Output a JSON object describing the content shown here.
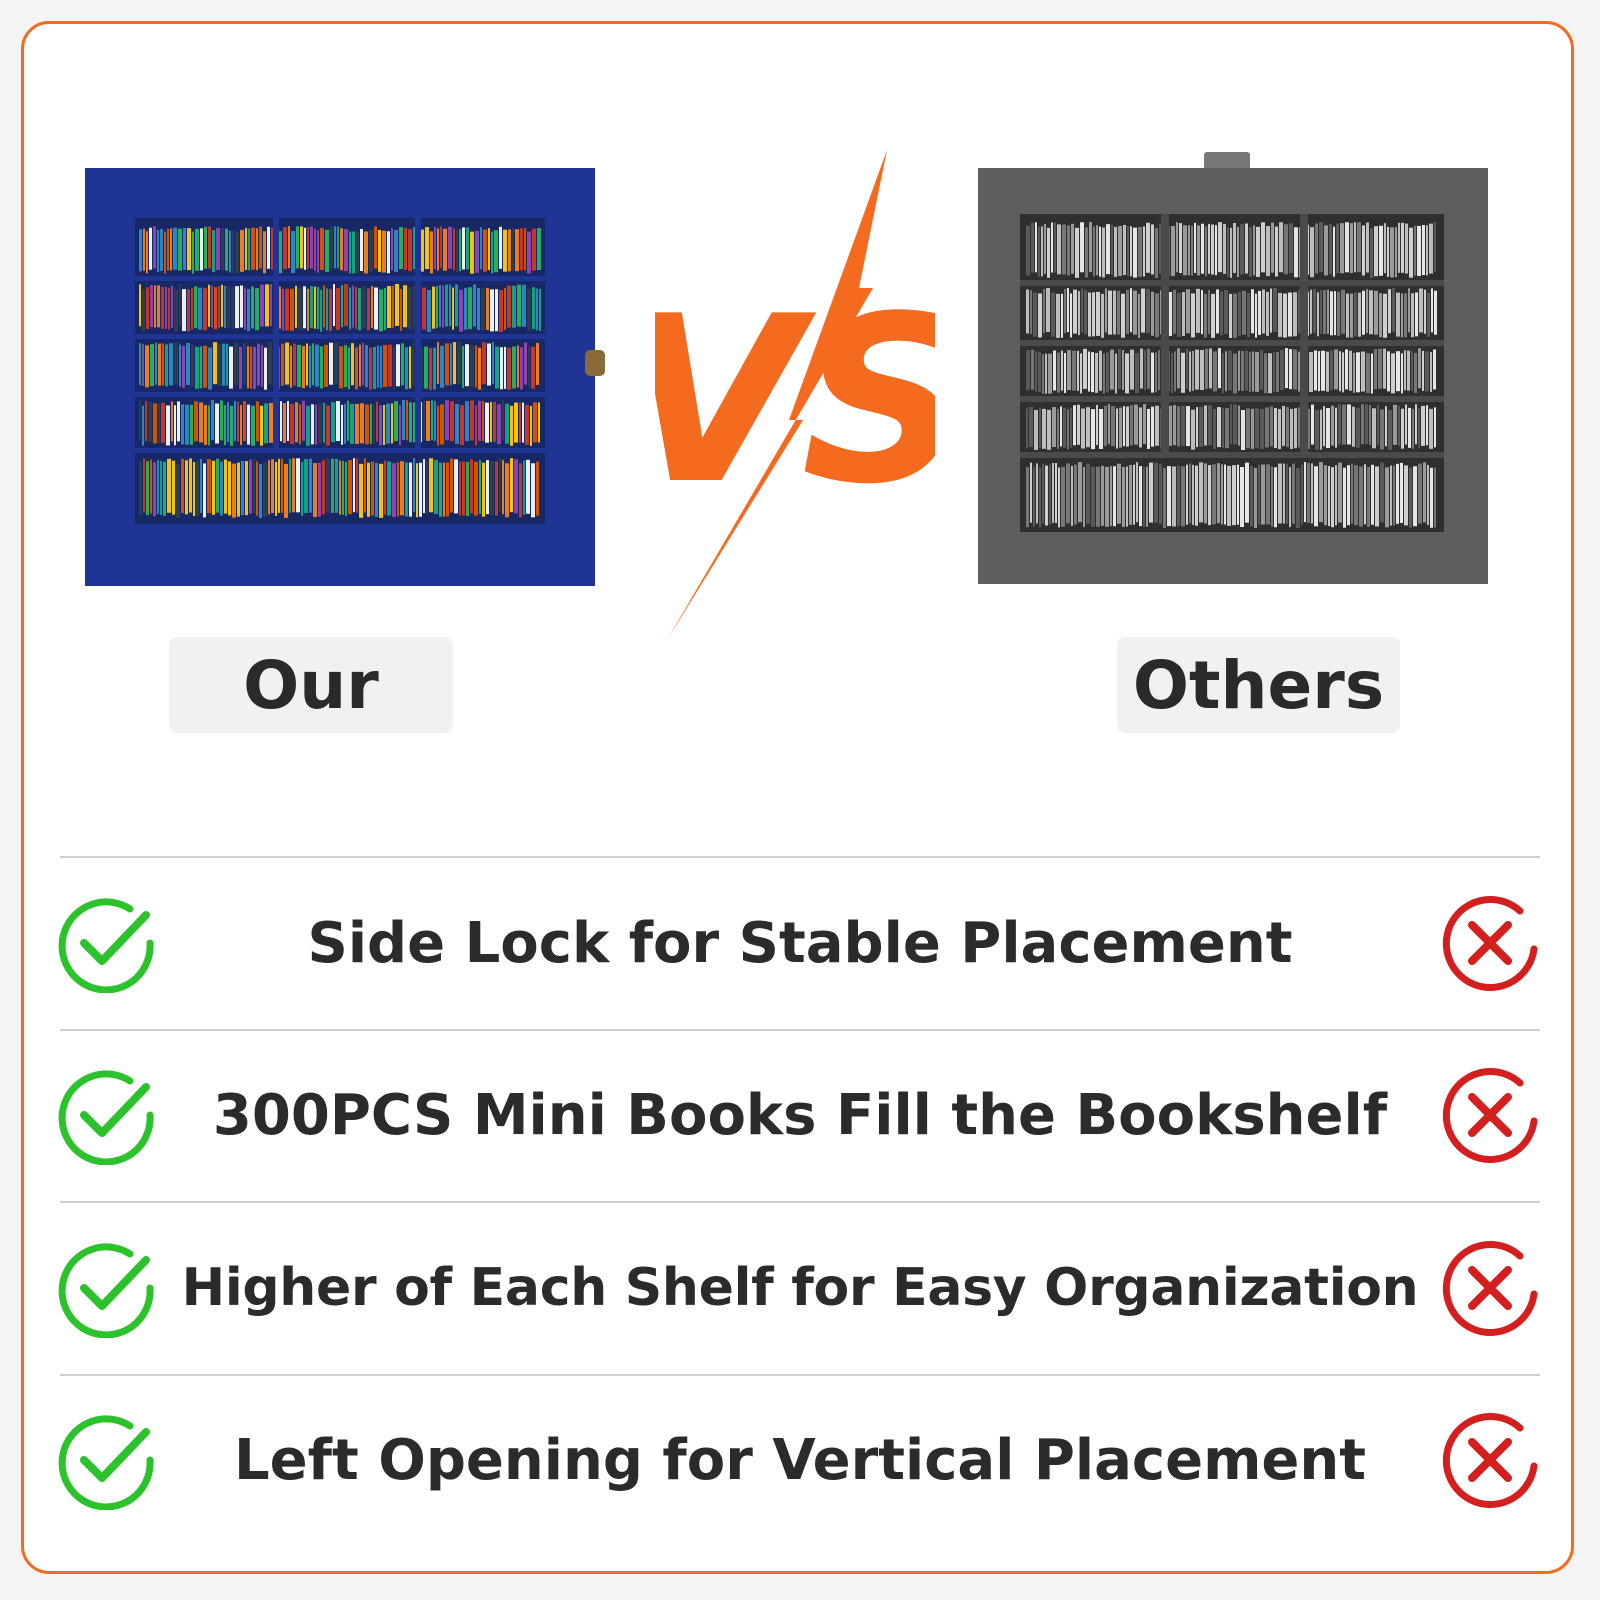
{
  "products": {
    "ours": {
      "label": "Our",
      "frame_color": "#1f3494"
    },
    "others": {
      "label": "Others",
      "frame_color": "#5e5e5e"
    }
  },
  "vs": {
    "text": "VS",
    "color": "#f46a1f"
  },
  "features": [
    {
      "text": "Side Lock for Stable Placement",
      "ours": "check-icon",
      "others": "cross-icon"
    },
    {
      "text": "300PCS Mini Books Fill the Bookshelf",
      "ours": "check-icon",
      "others": "cross-icon"
    },
    {
      "text": "Higher of Each Shelf for Easy Organization",
      "ours": "check-icon",
      "others": "cross-icon"
    },
    {
      "text": "Left Opening for Vertical Placement",
      "ours": "check-icon",
      "others": "cross-icon"
    }
  ],
  "colors": {
    "accent": "#f46a1f",
    "check": "#2bc22b",
    "cross": "#d41f1f",
    "text": "#2b2b2b"
  }
}
